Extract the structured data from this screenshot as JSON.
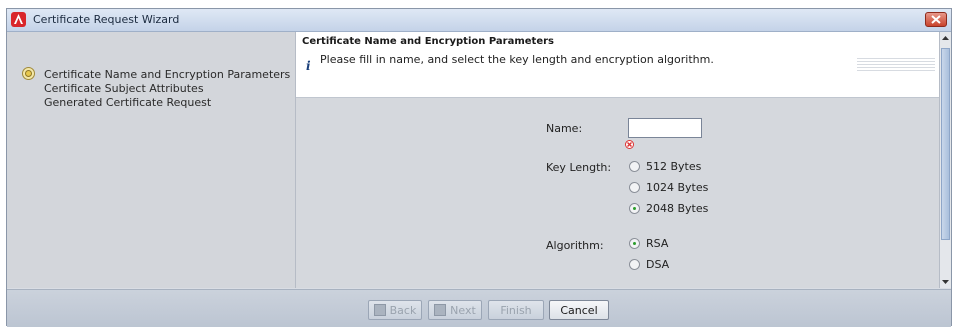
{
  "window": {
    "title": "Certificate Request Wizard"
  },
  "sidebar": {
    "steps": [
      {
        "label": "Certificate Name and Encryption Parameters",
        "active": true
      },
      {
        "label": "Certificate Subject Attributes",
        "active": false
      },
      {
        "label": "Generated Certificate Request",
        "active": false
      }
    ]
  },
  "header": {
    "title": "Certificate Name and Encryption Parameters",
    "description": "Please fill in name, and select the key length and encryption algorithm.",
    "info_icon": "i"
  },
  "form": {
    "name_label": "Name:",
    "name_value": "",
    "key_length_label": "Key Length:",
    "key_lengths": [
      {
        "label": "512 Bytes",
        "checked": false
      },
      {
        "label": "1024 Bytes",
        "checked": false
      },
      {
        "label": "2048 Bytes",
        "checked": true
      }
    ],
    "algorithm_label": "Algorithm:",
    "algorithms": [
      {
        "label": "RSA",
        "checked": true
      },
      {
        "label": "DSA",
        "checked": false
      }
    ]
  },
  "buttons": {
    "back": "Back",
    "next": "Next",
    "finish": "Finish",
    "cancel": "Cancel"
  },
  "icons": {
    "app": "acrobat-icon",
    "close": "close-icon",
    "step": "wizard-step-icon",
    "info": "info-icon",
    "error": "error-icon"
  },
  "colors": {
    "app_icon": "#d9262b",
    "radio_checked": "#2a9c2a",
    "close_button": "#c9432c"
  }
}
